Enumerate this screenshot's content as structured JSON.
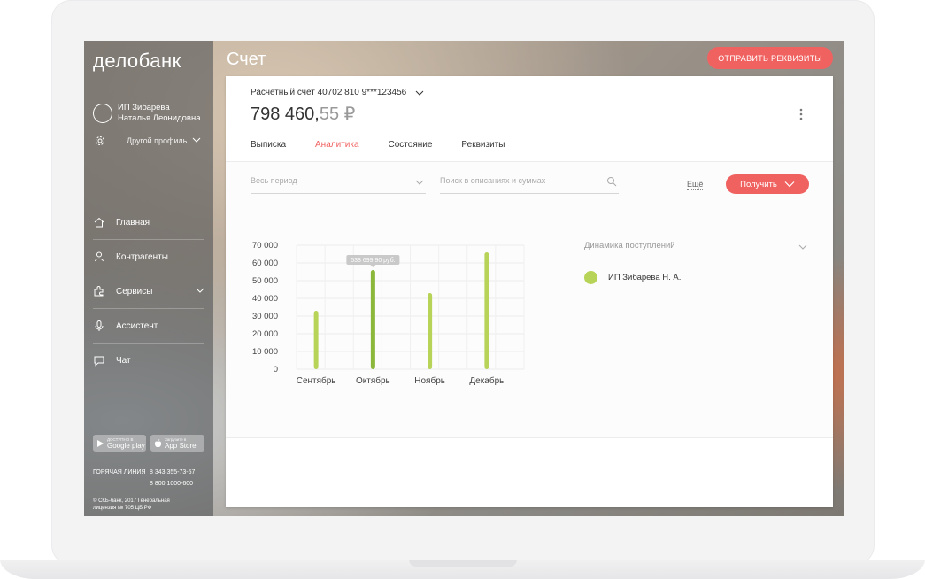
{
  "sidebar": {
    "logo": "делобанк",
    "profile": {
      "line1": "ИП Зибарева",
      "line2": "Наталья Леонидовна"
    },
    "other_profile": "Другой профиль",
    "nav": [
      {
        "label": "Главная",
        "icon": "home-icon"
      },
      {
        "label": "Контрагенты",
        "icon": "person-icon"
      },
      {
        "label": "Сервисы",
        "icon": "puzzle-icon"
      },
      {
        "label": "Ассистент",
        "icon": "microphone-icon"
      },
      {
        "label": "Чат",
        "icon": "chat-icon"
      }
    ],
    "stores": {
      "google": {
        "small": "ДОСТУПНО В",
        "big": "Google play"
      },
      "apple": {
        "small": "Загрузите в",
        "big": "App Store"
      }
    },
    "hotline": {
      "label": "ГОРЯЧАЯ ЛИНИЯ",
      "phone1": "8 343 355-73-57",
      "phone2": "8 800 1000-600"
    },
    "copyright": {
      "line1": "© СКБ-банк, 2017 Генеральная",
      "line2": "лицензия № 705 ЦБ РФ"
    }
  },
  "header": {
    "title": "Счет",
    "send_button": "ОТПРАВИТЬ РЕКВИЗИТЫ"
  },
  "account": {
    "label": "Расчетный счет 40702 810 9***123456",
    "balance_int": "798 460,",
    "balance_frac": "55 ₽"
  },
  "tabs": [
    {
      "label": "Выписка",
      "active": false
    },
    {
      "label": "Аналитика",
      "active": true
    },
    {
      "label": "Состояние",
      "active": false
    },
    {
      "label": "Реквизиты",
      "active": false
    }
  ],
  "filters": {
    "period_placeholder": "Весь период",
    "search_placeholder": "Поиск в описаниях и суммах",
    "more": "Ещё",
    "get_button": "Получить"
  },
  "analytics": {
    "dynamics_select": "Динамика поступлений",
    "legend": "ИП Зибарева Н. А."
  },
  "colors": {
    "accent": "#f06260",
    "bar": "#b7d458",
    "bar_active": "#8bb83b"
  },
  "chart_data": {
    "type": "bar",
    "categories": [
      "Сентябрь",
      "Октябрь",
      "Ноябрь",
      "Декабрь"
    ],
    "series": [
      {
        "name": "ИП Зибарева Н. А.",
        "values": [
          33000,
          56000,
          43000,
          66000
        ]
      }
    ],
    "ylim": [
      0,
      70000
    ],
    "yticks": [
      "70 000",
      "60 000",
      "50 000",
      "40 000",
      "30 000",
      "20 000",
      "10 000",
      "0"
    ],
    "tooltip": "538 699,90 руб.",
    "highlighted_index": 1,
    "grid": true
  }
}
